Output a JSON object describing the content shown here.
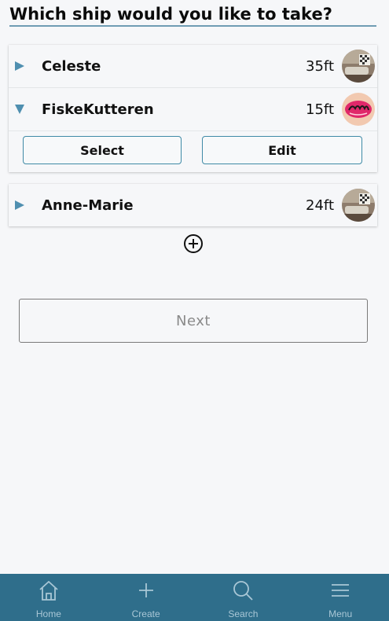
{
  "page": {
    "title": "Which ship would you like to take?"
  },
  "ships": [
    {
      "name": "Celeste",
      "length": "35ft",
      "expanded": false,
      "avatar": "room-photo"
    },
    {
      "name": "FiskeKutteren",
      "length": "15ft",
      "expanded": true,
      "avatar": "pink-logo"
    },
    {
      "name": "Anne-Marie",
      "length": "24ft",
      "expanded": false,
      "avatar": "room-photo"
    }
  ],
  "actions": {
    "select_label": "Select",
    "edit_label": "Edit"
  },
  "add": {
    "icon": "plus-circle-icon"
  },
  "next_label": "Next",
  "nav": {
    "items": [
      {
        "label": "Home",
        "icon": "home-icon"
      },
      {
        "label": "Create",
        "icon": "plus-icon"
      },
      {
        "label": "Search",
        "icon": "search-icon"
      },
      {
        "label": "Menu",
        "icon": "menu-icon"
      }
    ]
  },
  "colors": {
    "accent": "#3f8aa6",
    "caret": "#4f8fb0",
    "nav_bg": "#2f6e8b",
    "nav_label": "#a9c7d6"
  }
}
